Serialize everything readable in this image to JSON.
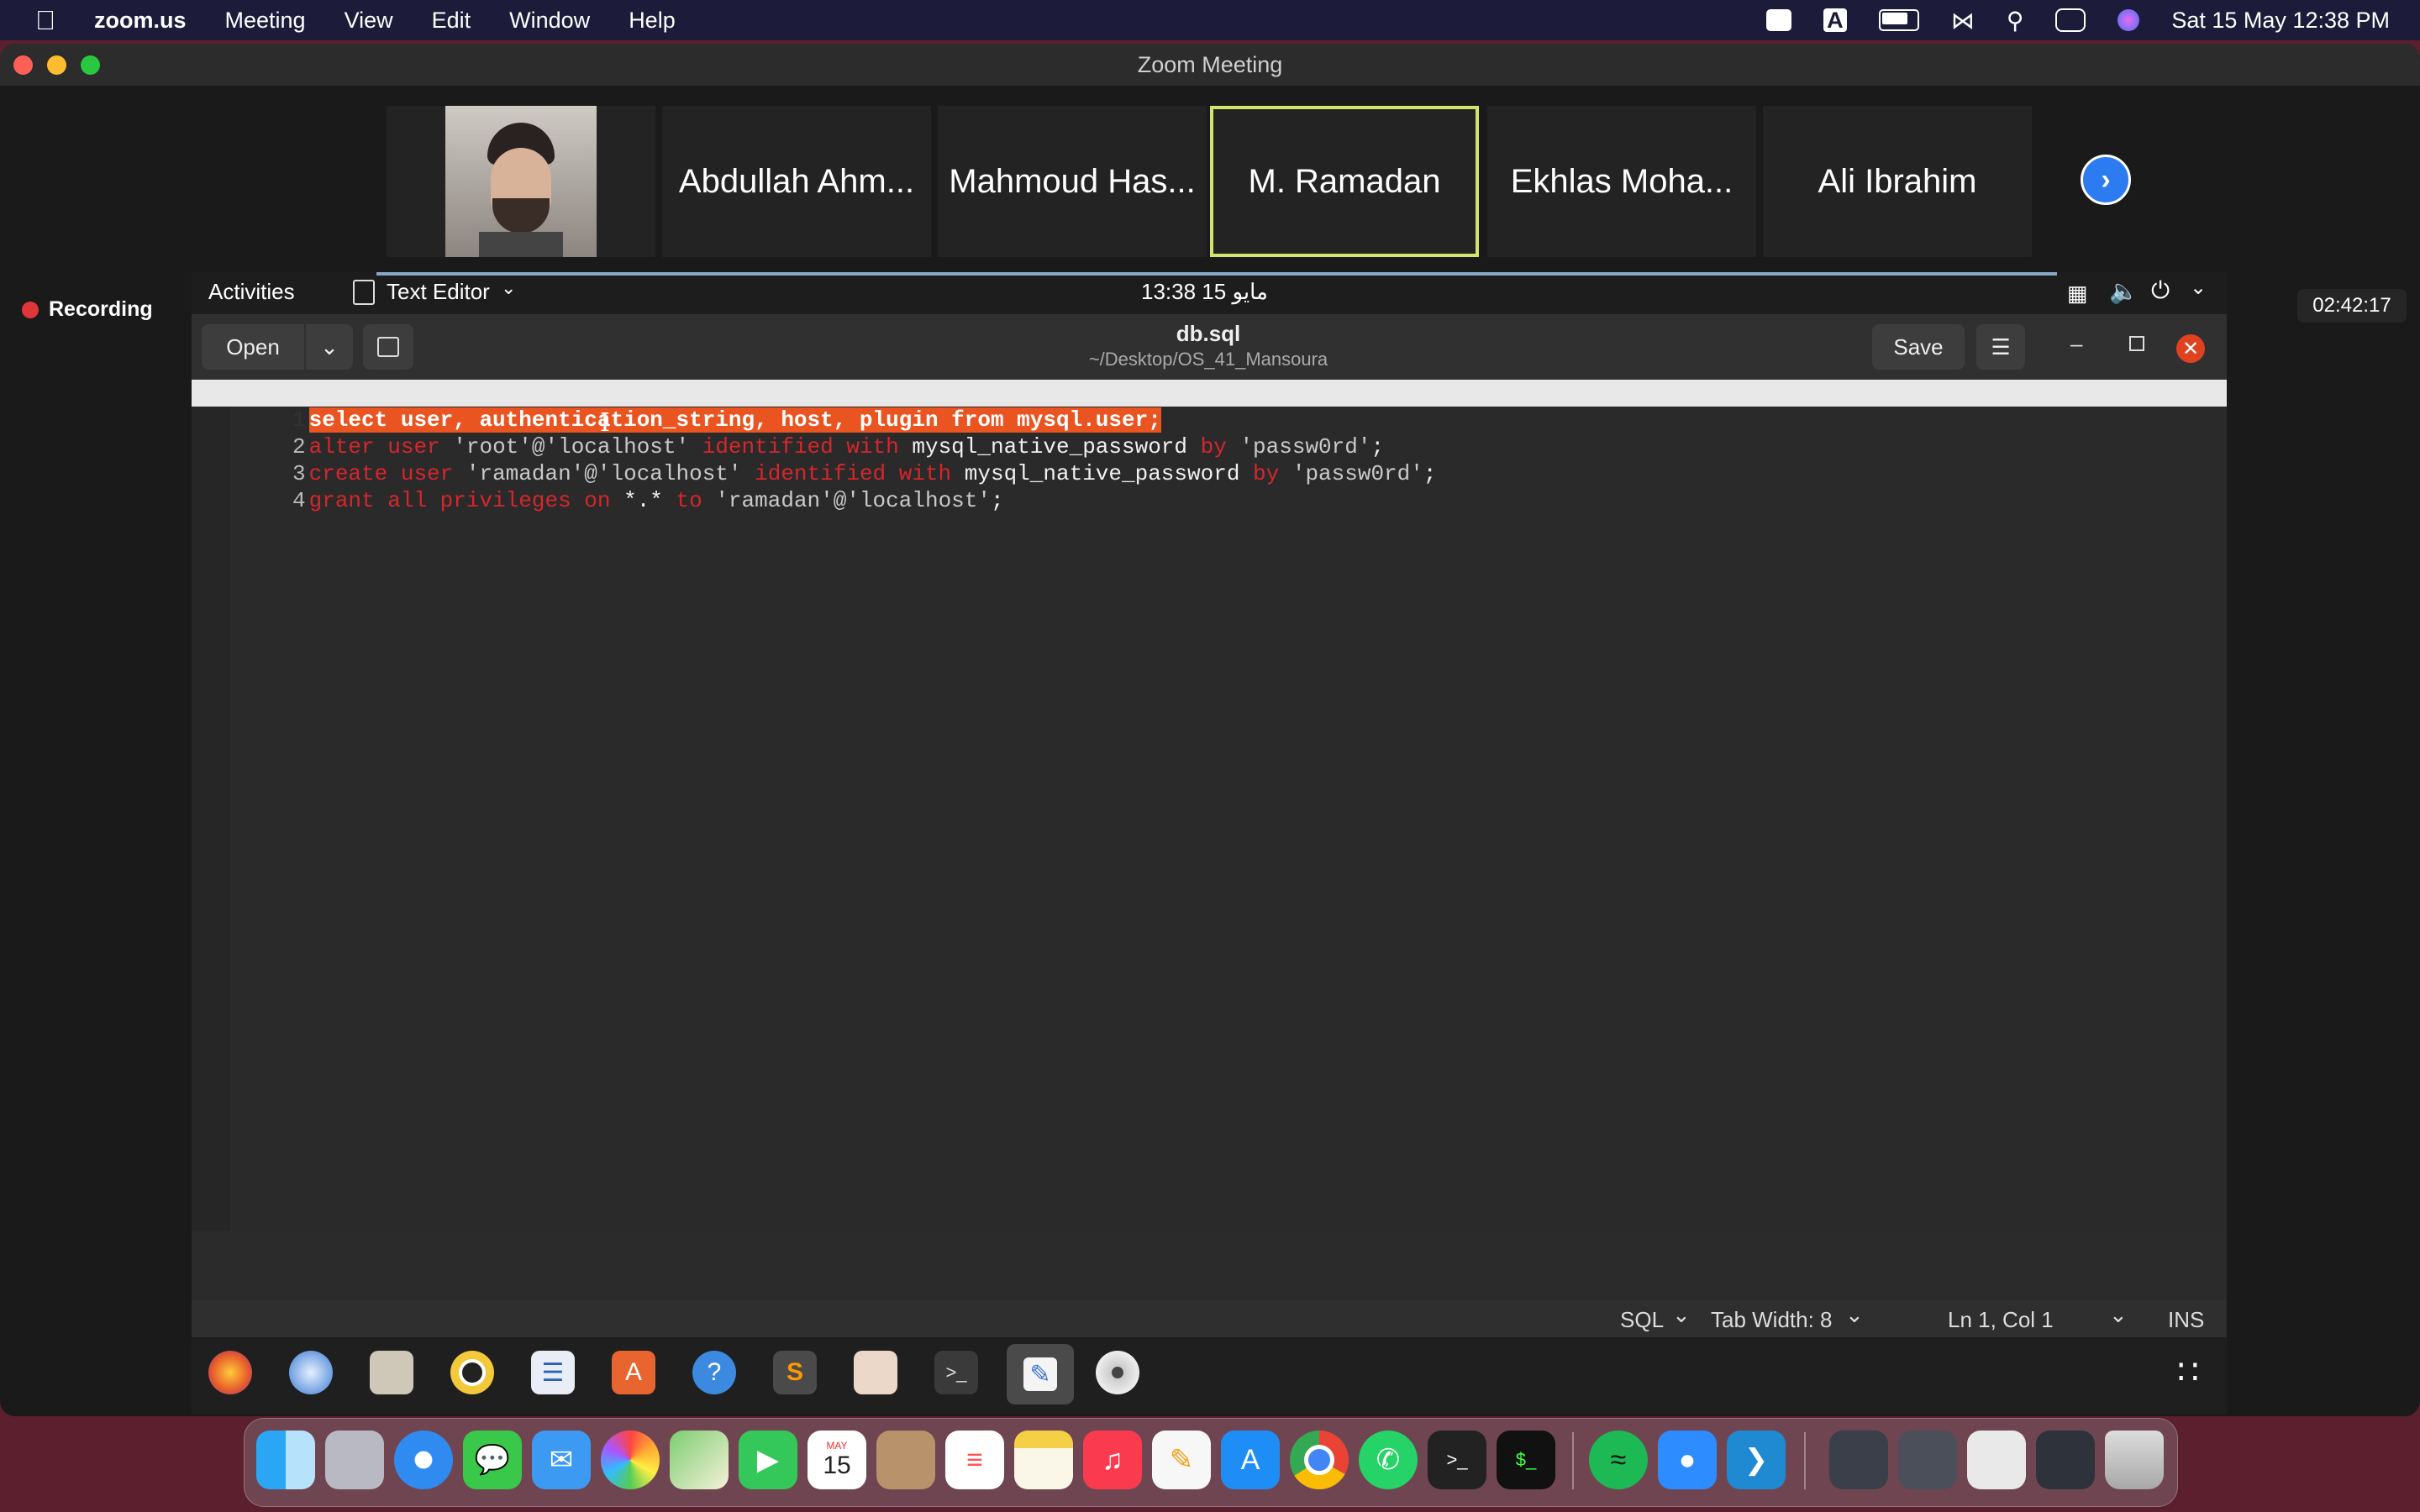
{
  "menubar": {
    "app": "zoom.us",
    "items": [
      "Meeting",
      "View",
      "Edit",
      "Window",
      "Help"
    ],
    "datetime": "Sat 15 May  12:38 PM"
  },
  "zoom": {
    "title": "Zoom Meeting",
    "participants": [
      "Abdullah Ahm...",
      "Mahmoud Has...",
      "M. Ramadan",
      "Ekhlas Moha...",
      "Ali Ibrahim"
    ],
    "active_speaker": "M. Ramadan",
    "recording_label": "Recording",
    "timer": "02:42:17"
  },
  "ubuntu": {
    "activities": "Activities",
    "app_menu": "Text Editor",
    "clock": "13:38  15 مايو",
    "open_label": "Open",
    "save_label": "Save",
    "file_name": "db.sql",
    "file_path": "~/Desktop/OS_41_Mansoura",
    "status": {
      "language": "SQL",
      "tab_width": "Tab Width: 8",
      "position": "Ln 1, Col 1",
      "mode": "INS"
    }
  },
  "code": {
    "lines": [
      "select user, authentication_string, host, plugin from mysql.user;",
      "alter user 'root'@'localhost' identified with mysql_native_password by 'passw0rd';",
      "create user 'ramadan'@'localhost' identified with mysql_native_password by 'passw0rd';",
      "grant all privileges on *.* to 'ramadan'@'localhost';"
    ],
    "selected_line": 1
  },
  "colors": {
    "selection": "#e95420",
    "keyword": "#d6262c",
    "active_speaker_border": "#d4e36a",
    "recording_dot": "#e0363a"
  }
}
